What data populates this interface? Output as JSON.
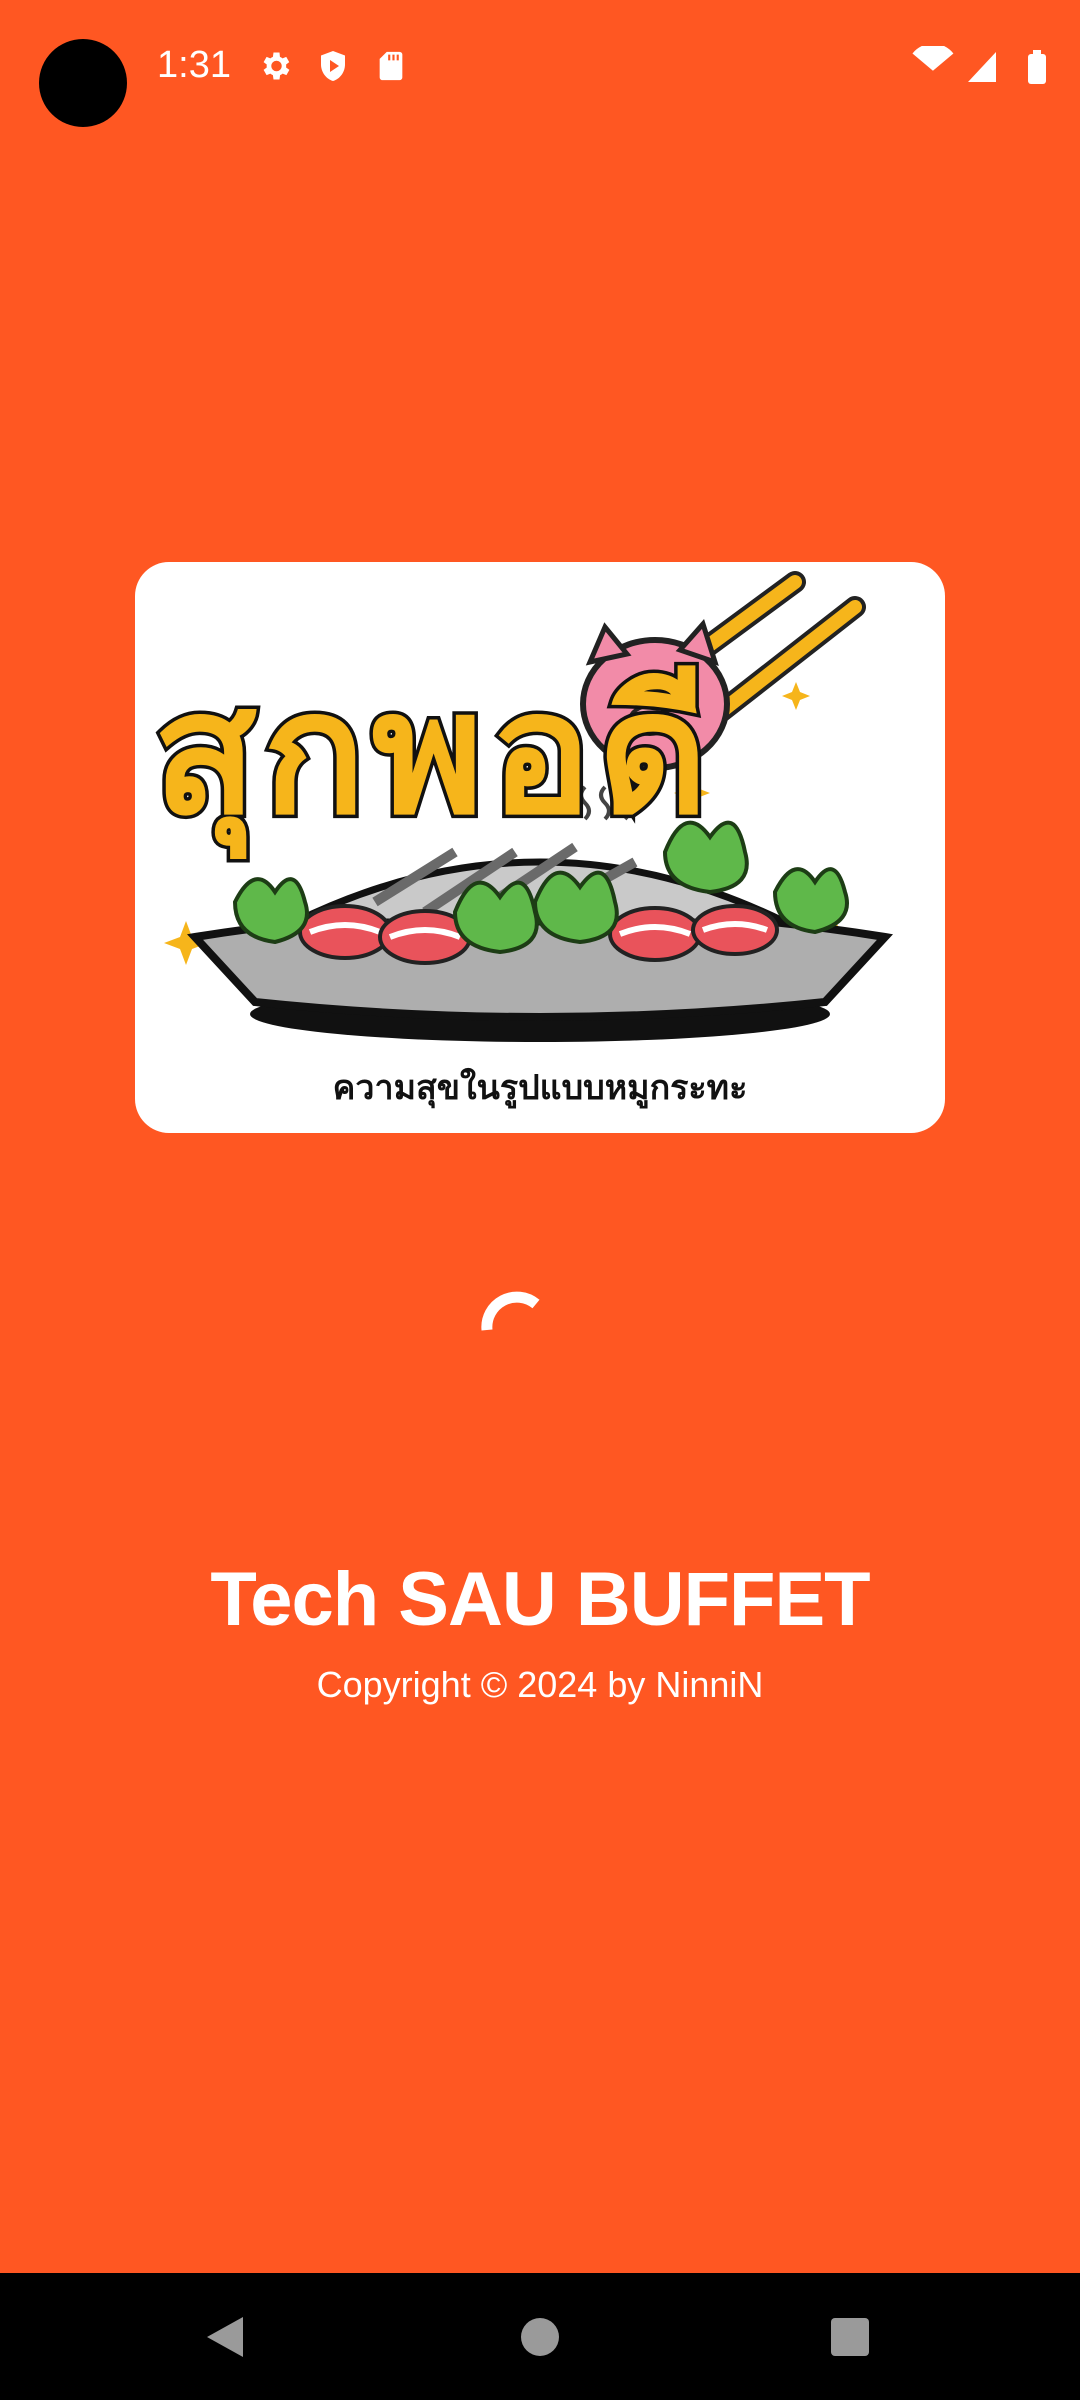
{
  "status_bar": {
    "time": "1:31",
    "left_icons": [
      "settings-icon",
      "shield-play-icon",
      "sd-card-icon"
    ],
    "right_icons": [
      "wifi-icon",
      "signal-icon",
      "battery-icon"
    ]
  },
  "logo": {
    "title_thai": "สุกพอดี",
    "caption": "ความสุขในรูปแบบหมูกระทะ"
  },
  "loading": {
    "indicator": "spinner"
  },
  "app": {
    "title": "Tech SAU BUFFET",
    "copyright": "Copyright © 2024 by NinniN"
  },
  "nav": {
    "back": "back-icon",
    "home": "home-icon",
    "recents": "recents-icon"
  },
  "colors": {
    "background": "#FF5722",
    "card": "#FFFFFF",
    "logo_yellow": "#F6B51B",
    "logo_pink": "#F28BA8",
    "nav_bar": "#000000"
  }
}
